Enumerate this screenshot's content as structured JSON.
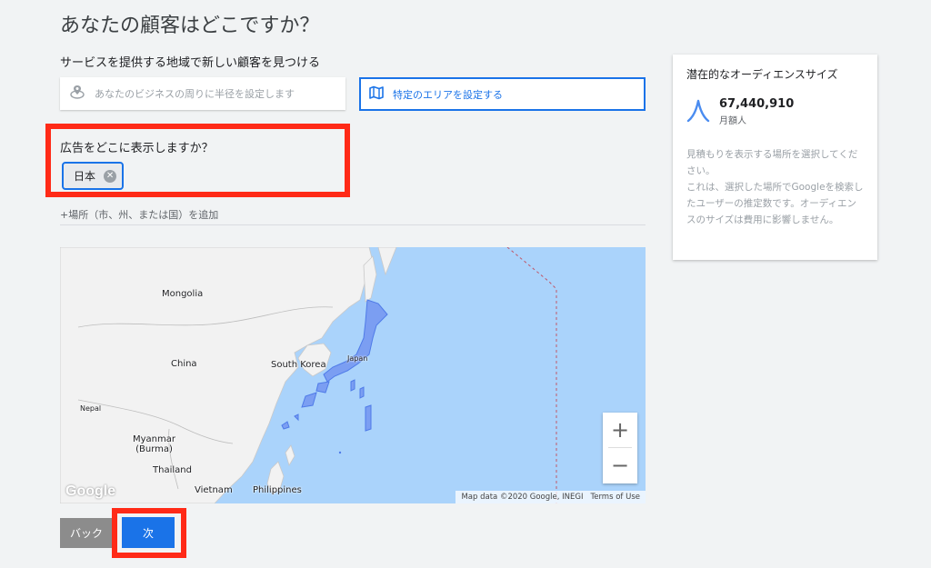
{
  "page": {
    "title": "あなたの顧客はどこですか？"
  },
  "services": {
    "title": "サービスを提供する地域で新しい顧客を見つける",
    "radius_option": "あなたのビジネスの周りに半径を設定します",
    "area_option": "特定のエリアを設定する"
  },
  "ad_location": {
    "question": "広告をどこに表示しますか？",
    "selected_chip": "日本",
    "add_link": "+場所（市、州、または国）を追加"
  },
  "map": {
    "labels": {
      "mongolia": "Mongolia",
      "china": "China",
      "south_korea": "South Korea",
      "japan": "Japan",
      "nepal": "Nepal",
      "myanmar": "Myanmar\n(Burma)",
      "thailand": "Thailand",
      "vietnam": "Vietnam",
      "philippines": "Philippines"
    },
    "zoom_in": "+",
    "zoom_out": "−",
    "google_logo": "Google",
    "attribution": "Map data ©2020 Google, INEGI",
    "terms": "Terms of Use",
    "colors": {
      "water": "#aad3fb",
      "land": "#f2f2f2",
      "selected": "#7b9ef2"
    }
  },
  "audience": {
    "title": "潜在的なオーディエンスサイズ",
    "count": "67,440,910",
    "unit": "月額人",
    "description": "見積もりを表示する場所を選択してください。\nこれは、選択した場所でGoogleを検索したユーザーの推定数です。オーディエンスのサイズは費用に影響しません。"
  },
  "buttons": {
    "back": "バック",
    "next": "次"
  },
  "colors": {
    "accent": "#1a73e8",
    "highlight": "#ff2a17"
  }
}
